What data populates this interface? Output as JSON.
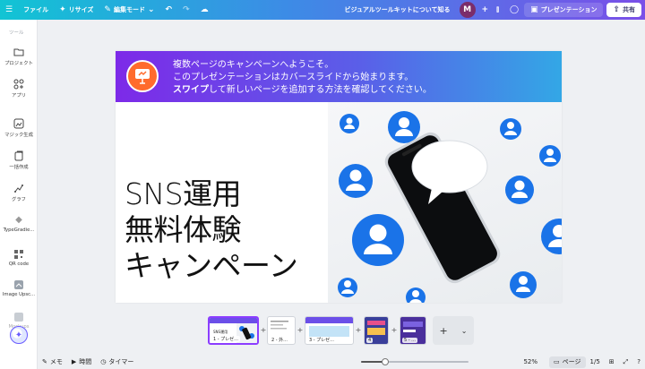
{
  "topbar": {
    "menu_icon": "hamburger-icon",
    "file": "ファイル",
    "resize": "リサイズ",
    "edit_mode": "編集モード",
    "visual_toolkit": "ビジュアルツールキットについて知る",
    "avatar_initial": "M",
    "present": "プレゼンテーション",
    "share": "共有"
  },
  "rail": {
    "heading": "ツール",
    "items": [
      {
        "label": "プロジェクト",
        "icon": "folder-icon"
      },
      {
        "label": "アプリ",
        "icon": "apps-icon"
      },
      {
        "label": "マジック生成",
        "icon": "magic-media-icon"
      },
      {
        "label": "一括作成",
        "icon": "bulk-create-icon"
      },
      {
        "label": "グラフ",
        "icon": "chart-icon"
      },
      {
        "label": "TypeGradie...",
        "icon": "type-gradient-icon"
      },
      {
        "label": "QR code",
        "icon": "qr-code-icon"
      },
      {
        "label": "Image Upsc...",
        "icon": "image-upscaler-icon"
      },
      {
        "label": "Mockups",
        "icon": "mockups-icon"
      }
    ]
  },
  "canvas": {
    "banner_line1": "複数ページのキャンペーンへようこそ。",
    "banner_line2": "このプレゼンテーションはカバースライドから始まります。",
    "banner_line3_bold": "スワイプ",
    "banner_line3_rest": "して新しいページを追加する方法を確認してください。",
    "title_line1": "SNS運用",
    "title_line2": "無料体験",
    "title_line3": "キャンペーン"
  },
  "pages": [
    {
      "label": "1 - プレゼ...",
      "caption": "SNS運用"
    },
    {
      "label": "2 - 外...",
      "caption": ""
    },
    {
      "label": "3 - プレゼ...",
      "caption": ""
    },
    {
      "label": "4",
      "caption": ""
    },
    {
      "label": "5 - ...",
      "caption": ""
    }
  ],
  "bottombar": {
    "notes": "メモ",
    "timing": "時間",
    "timer": "タイマー",
    "zoom": "52%",
    "zoom_value": 52,
    "pages_view": "ページ",
    "page_count": "1/5"
  },
  "colors": {
    "brand_purple": "#8b3dff",
    "topbar_start": "#11c4d4",
    "topbar_end": "#7a4fe8",
    "social_blue": "#1a73e8"
  }
}
